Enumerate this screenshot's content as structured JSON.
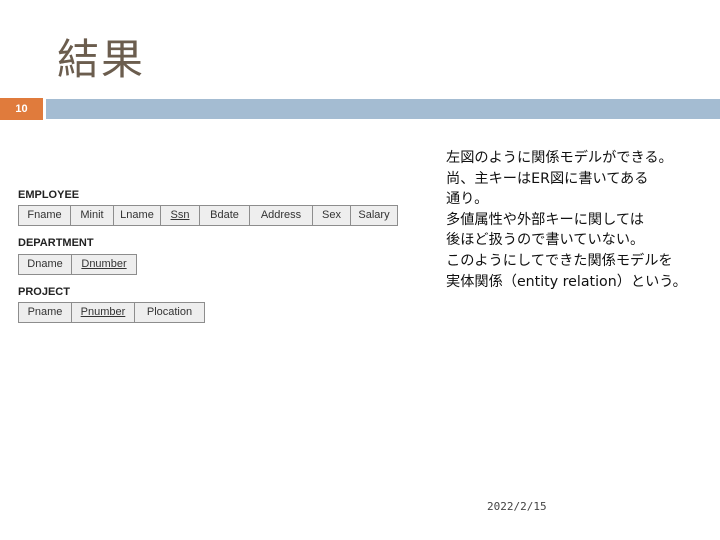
{
  "slide": {
    "title": "結果",
    "number": "10",
    "date": "2022/2/15"
  },
  "schema": {
    "employee": {
      "name": "EMPLOYEE",
      "attributes": [
        "Fname",
        "Minit",
        "Lname",
        "Ssn",
        "Bdate",
        "Address",
        "Sex",
        "Salary"
      ],
      "key": "Ssn"
    },
    "department": {
      "name": "DEPARTMENT",
      "attributes": [
        "Dname",
        "Dnumber"
      ],
      "key": "Dnumber"
    },
    "project": {
      "name": "PROJECT",
      "attributes": [
        "Pname",
        "Pnumber",
        "Plocation"
      ],
      "key": "Pnumber"
    }
  },
  "body": {
    "lines": [
      "左図のように関係モデルができる。",
      "尚、主キーはER図に書いてある",
      "通り。",
      "多値属性や外部キーに関しては",
      "後ほど扱うので書いていない。",
      "このようにしてできた関係モデルを",
      "実体関係（entity relation）という。"
    ]
  },
  "colors": {
    "title": "#6b5d4e",
    "slide_number_bg": "#e07b3c",
    "header_bar": "#a4bcd2",
    "table_fill": "#eeeeee"
  }
}
